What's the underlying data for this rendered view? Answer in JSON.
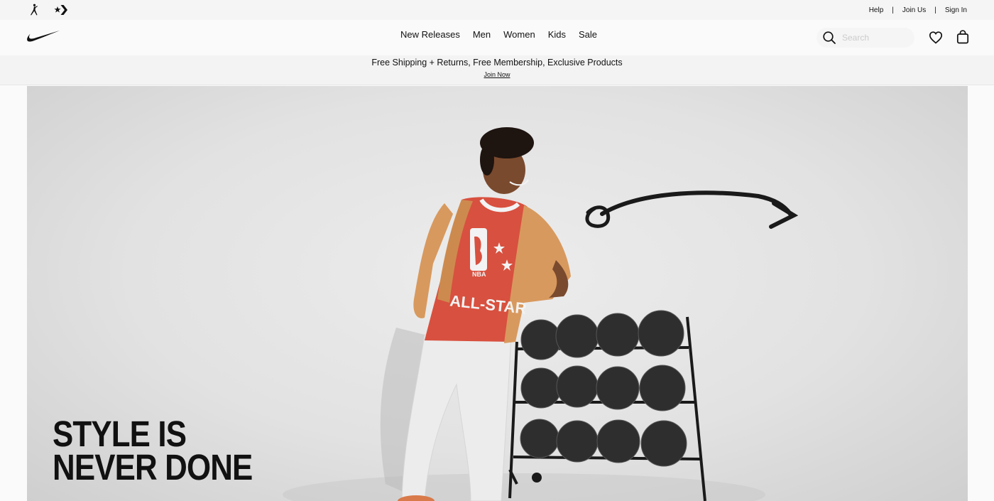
{
  "utility": {
    "brands": [
      {
        "icon": "jordan-jumpman-icon"
      },
      {
        "icon": "converse-star-chevron-icon"
      }
    ],
    "links": [
      "Help",
      "Join Us",
      "Sign In"
    ],
    "separator": "|"
  },
  "nav": {
    "logo_icon": "nike-swoosh-icon",
    "links": [
      "New Releases",
      "Men",
      "Women",
      "Kids",
      "Sale"
    ],
    "search_placeholder": "Search",
    "favorites_icon": "heart-icon",
    "bag_icon": "shopping-bag-icon"
  },
  "promo": {
    "message": "Free Shipping + Returns, Free Membership, Exclusive Products",
    "cta": "Join Now"
  },
  "hero": {
    "headline_line1": "STYLE IS",
    "headline_line2": "NEVER DONE",
    "jersey_text_top": "NBA",
    "jersey_text_main": "ALL-STAR",
    "colors": {
      "background": "#e4e4e4",
      "jersey": "#d8503f",
      "jacket": "#d8995e",
      "ink": "#111111"
    }
  }
}
